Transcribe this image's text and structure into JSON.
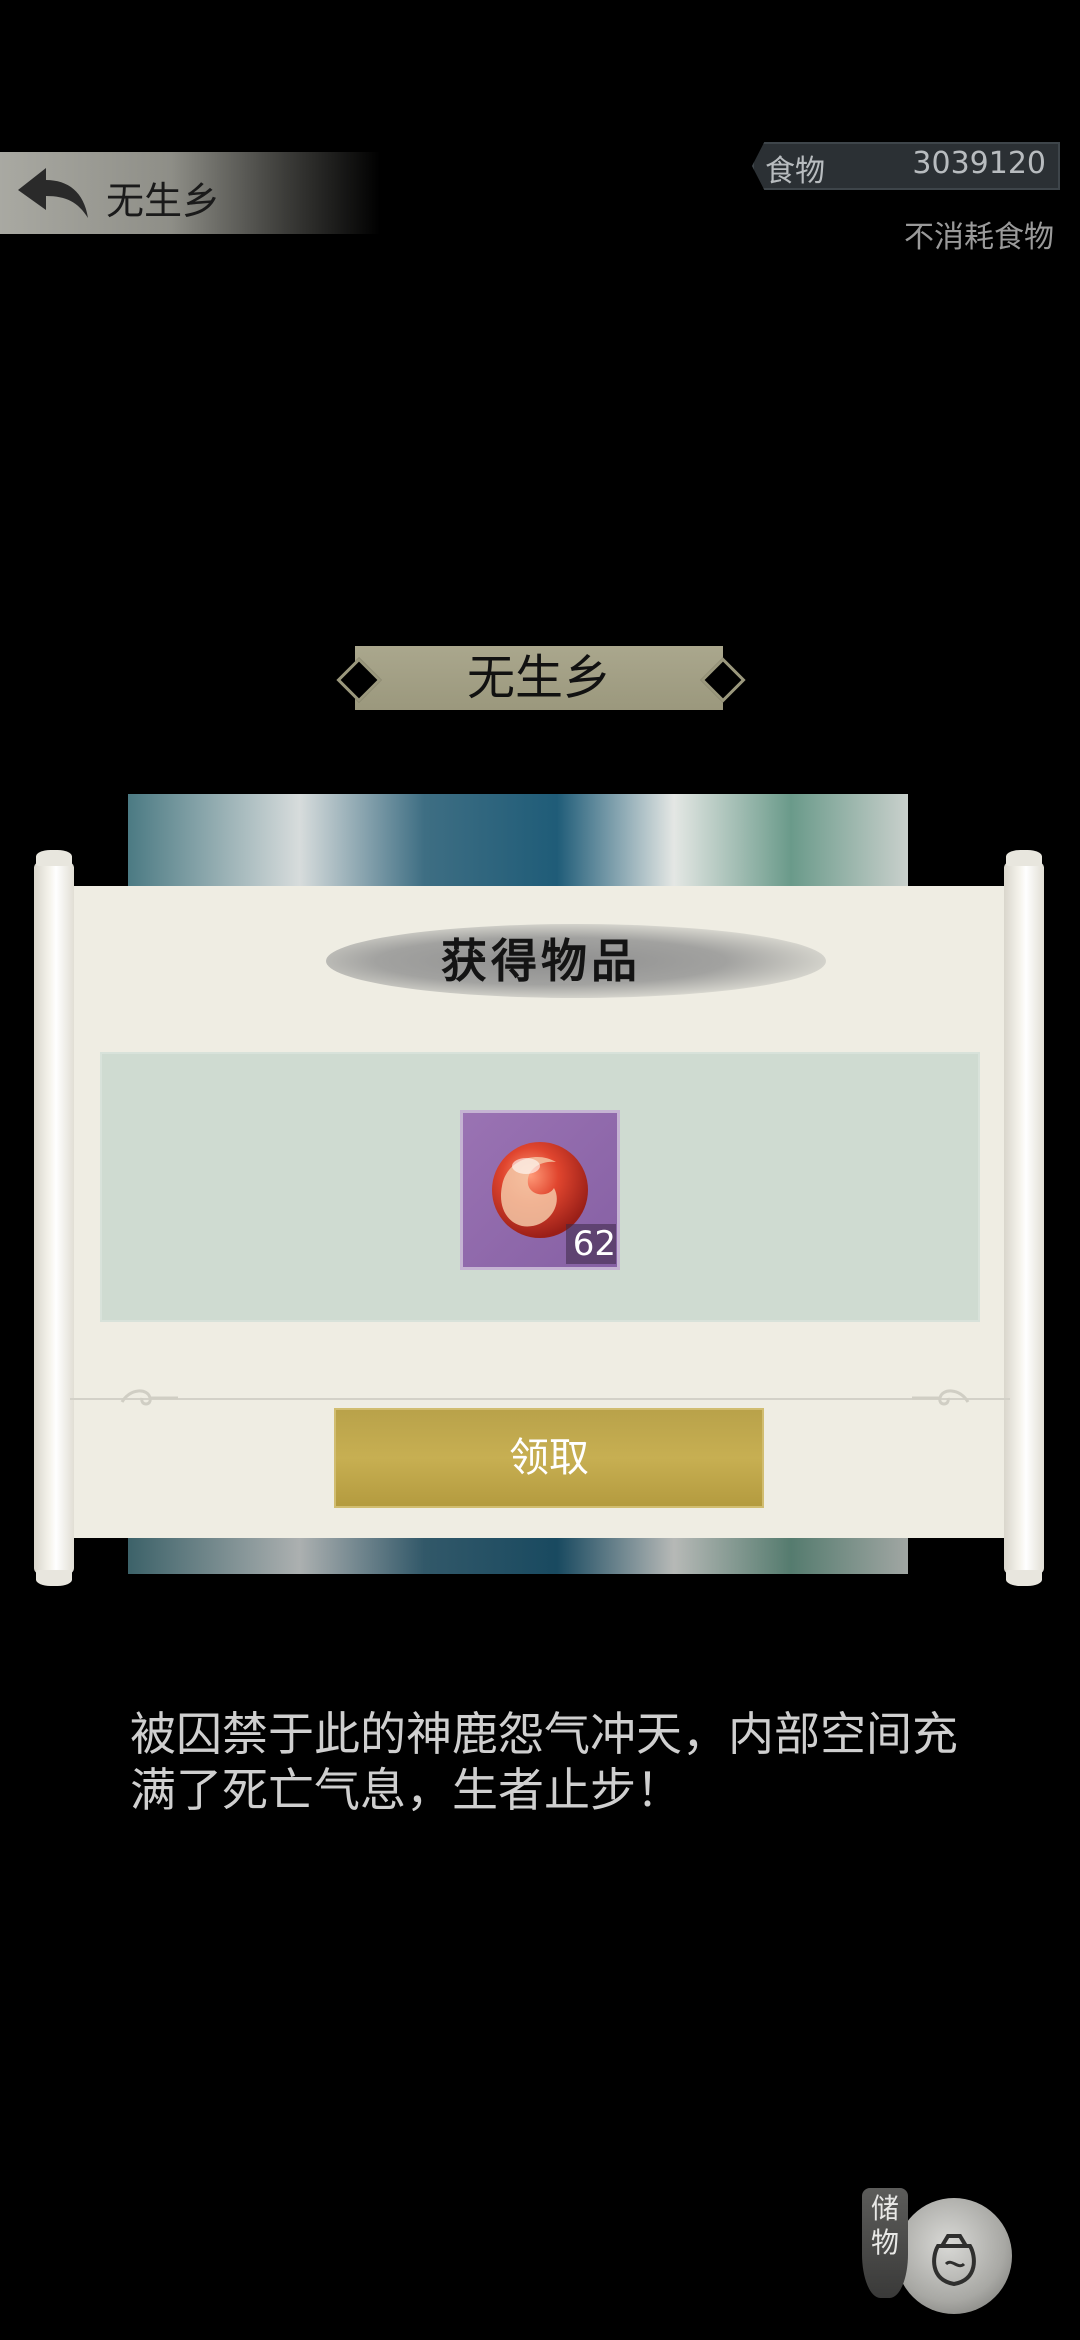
{
  "header": {
    "back_icon": "back-arrow-icon",
    "title": "无生乡"
  },
  "resources": {
    "food_label": "食物",
    "food_value": "3039120",
    "food_note": "不消耗食物"
  },
  "location": {
    "banner_title": "无生乡"
  },
  "reward_dialog": {
    "title": "获得物品",
    "items": [
      {
        "icon": "red-orb-icon",
        "count": "62"
      }
    ],
    "claim_label": "领取"
  },
  "description": "被囚禁于此的神鹿怨气冲天，内部空间充满了死亡气息，生者止步！",
  "storage": {
    "label": "储物",
    "icon": "storage-bag-icon"
  },
  "colors": {
    "background": "#000000",
    "scroll_paper": "#efede3",
    "item_panel": "#cfdbd1",
    "claim_button": "#c7af52",
    "item_slot": "#8660a4"
  }
}
